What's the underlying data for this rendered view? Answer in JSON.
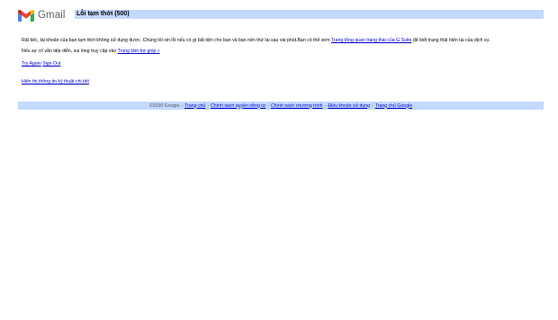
{
  "header": {
    "logo_text": "Gmail",
    "title": "Lỗi tạm thời (500)"
  },
  "message": {
    "line1_text": "Rất tiếc, tài khoản của bạn tạm thời không sử dụng được. Chúng tôi xin lỗi nếu có gì bất tiện cho bạn và bạn nên thử lại sau vài phút.Bạn có thể xem ",
    "line1_link": "Trang tổng quan trạng thái của G Suite",
    "line1_after": " để biết trạng thái hiện tại của dịch vụ.",
    "line2_text": "Nếu sự cố vẫn tiếp diễn, vui lòng truy cập vào ",
    "line2_link": "Trung tâm trợ giúp »"
  },
  "actions": {
    "try_again": "Try Again",
    "sign_out": "Sign Out"
  },
  "details_link": "Hiển thị thông tin kỹ thuật chi tiết",
  "footer": {
    "copyright": "©2020 Google",
    "separator": "-",
    "links": [
      "Trang chủ",
      "Chính sách quyền riêng tư",
      "Chính sách chương trình",
      "Điều khoản sử dụng",
      "Trang chủ Google"
    ]
  },
  "colors": {
    "bar": "#c3d9ff",
    "link": "#0000cc"
  },
  "icons": {
    "logo": "gmail-m-logo-icon"
  }
}
